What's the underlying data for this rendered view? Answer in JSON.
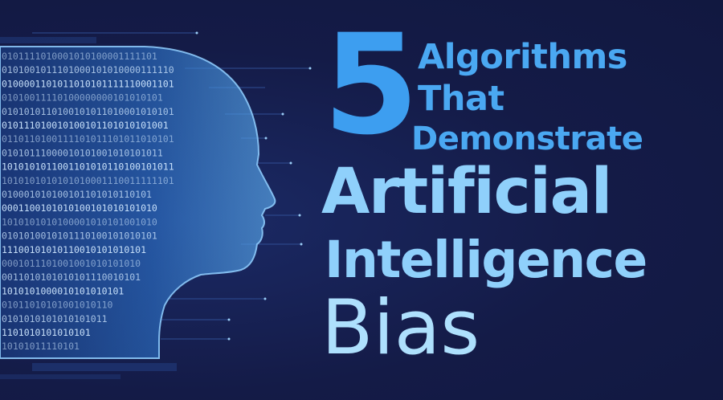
{
  "title": {
    "number": "5",
    "line1": "Algorithms",
    "line2": "That",
    "line3": "Demonstrate",
    "line4": "Artificial",
    "line5": "Intelligence",
    "line6": "Bias"
  },
  "binary_rows": [
    "0101111010001010100001111101",
    "0101001011101000101010000111110",
    "0100001101011010101111110001101",
    "01010011110100000000101010101",
    "0101010110100101011010001010101",
    "010111010010100101101010101001",
    "0110110100111101011101011010101",
    "01010111000010101001010101011",
    "1010101011001101010110100101011",
    "1010101010101010001110011111101",
    "010001010100101101010110101",
    "0001100101010100101010101010",
    "1010101010100001010101001010",
    "0101010010101110100101010101",
    "11100101010110010101010101",
    "0001011101001001010101010",
    "0011010101010101110010101",
    "1010101000010101010101",
    "01011010101001010110",
    "0101010101010101011",
    "1101010101010101",
    "10101011110101"
  ],
  "colors": {
    "background": "#141b47",
    "accent_dark": "#3d9ef0",
    "accent_light": "#8fd0fb",
    "accent_pale": "#aee0fd"
  },
  "icons": [
    "head-silhouette-icon"
  ]
}
